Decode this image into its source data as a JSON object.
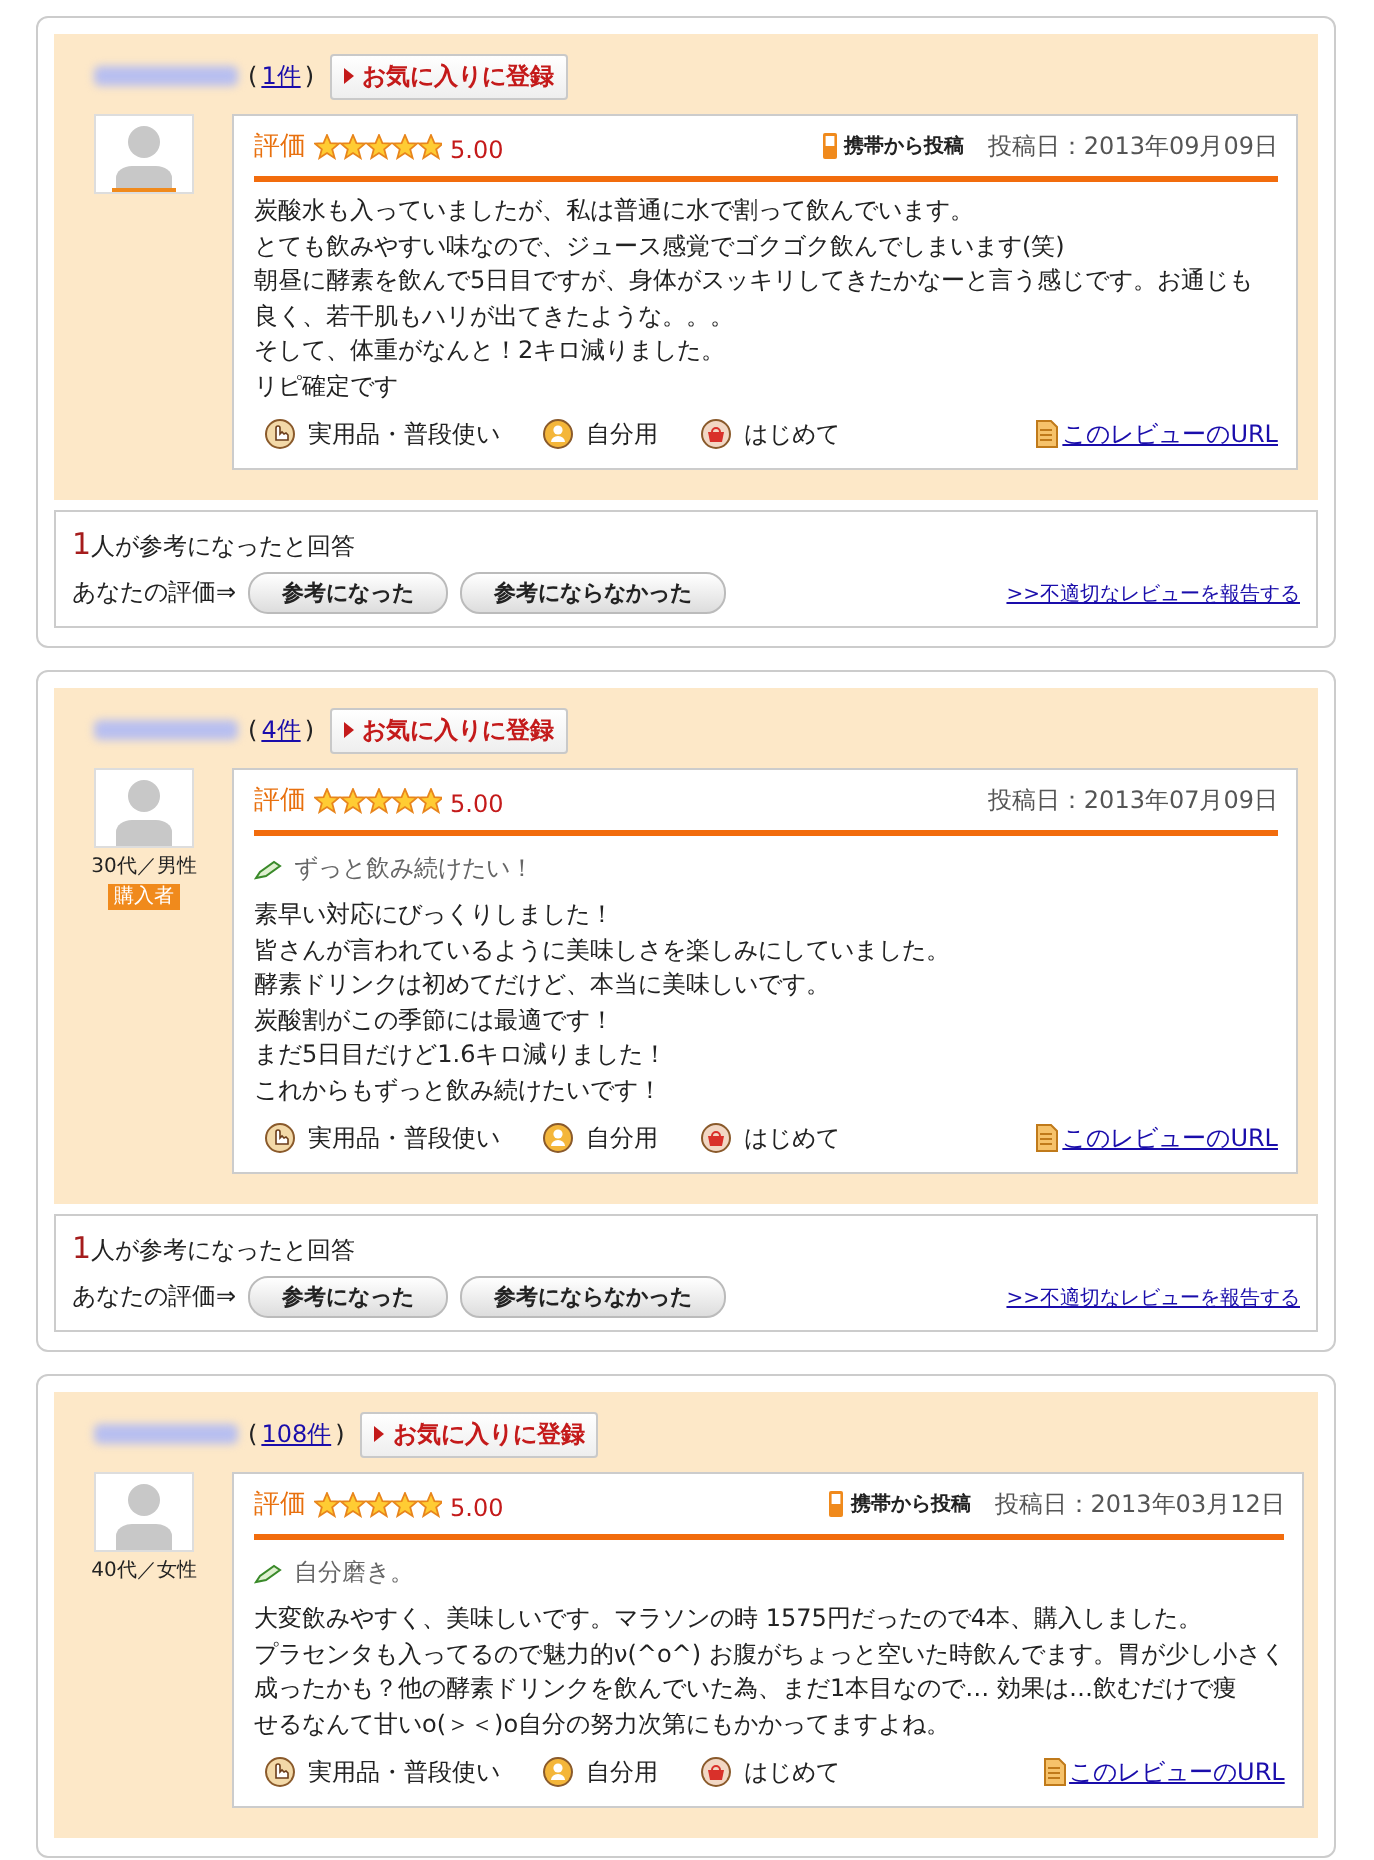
{
  "reviews": [
    {
      "count": {
        "open": "(",
        "link": "1件",
        "close": ")"
      },
      "favorite": "お気に入りに登録",
      "rating_label": "評価",
      "stars": 5,
      "score": "5.00",
      "mobile": "携帯から投稿",
      "date": "投稿日：2013年09月09日",
      "body": [
        "炭酸水も入っていましたが、私は普通に水で割って飲んでいます。",
        "とても飲みやすい味なので、ジュース感覚でゴクゴク飲んでしまいます(笑)",
        "朝昼に酵素を飲んで5日目ですが、身体がスッキリしてきたかなーと言う感じです。お通じも",
        "良く、若干肌もハリが出てきたような。。。",
        "そして、体重がなんと！2キロ減りました。",
        "リピ確定です"
      ],
      "tags": [
        {
          "kind": "use",
          "label": "実用品・普段使い"
        },
        {
          "kind": "self",
          "label": "自分用"
        },
        {
          "kind": "first",
          "label": "はじめて"
        }
      ],
      "url_link": "このレビューのURL",
      "helpful": {
        "count": "1",
        "text": "人が参考になったと回答",
        "prompt": "あなたの評価⇒",
        "buttons": [
          "参考になった",
          "参考にならなかった"
        ],
        "report": ">>不適切なレビューを報告する"
      }
    },
    {
      "count": {
        "open": "(",
        "link": "4件",
        "close": ")"
      },
      "favorite": "お気に入りに登録",
      "demographic": "30代／男性",
      "purchaser": "購入者",
      "rating_label": "評価",
      "stars": 5,
      "score": "5.00",
      "date": "投稿日：2013年07月09日",
      "title": "ずっと飲み続けたい！",
      "body": [
        "素早い対応にびっくりしました！",
        "皆さんが言われているように美味しさを楽しみにしていました。",
        "酵素ドリンクは初めてだけど、本当に美味しいです。",
        "炭酸割がこの季節には最適です！",
        "まだ5日目だけど1.6キロ減りました！",
        "これからもずっと飲み続けたいです！"
      ],
      "tags": [
        {
          "kind": "use",
          "label": "実用品・普段使い"
        },
        {
          "kind": "self",
          "label": "自分用"
        },
        {
          "kind": "first",
          "label": "はじめて"
        }
      ],
      "url_link": "このレビューのURL",
      "helpful": {
        "count": "1",
        "text": "人が参考になったと回答",
        "prompt": "あなたの評価⇒",
        "buttons": [
          "参考になった",
          "参考にならなかった"
        ],
        "report": ">>不適切なレビューを報告する"
      }
    },
    {
      "count": {
        "open": "(",
        "link": "108件",
        "close": ")"
      },
      "favorite": "お気に入りに登録",
      "demographic": "40代／女性",
      "rating_label": "評価",
      "stars": 5,
      "score": "5.00",
      "mobile": "携帯から投稿",
      "date": "投稿日：2013年03月12日",
      "title": "自分磨き。",
      "body": [
        "大変飲みやすく、美味しいです。マラソンの時 1575円だったので4本、購入しました。",
        "プラセンタも入ってるので魅力的ν(^o^) お腹がちょっと空いた時飲んでます。胃が少し小さく",
        "成ったかも？他の酵素ドリンクを飲んでいた為、まだ1本目なので… 効果は…飲むだけで痩",
        "せるなんて甘いo(＞＜)o自分の努力次第にもかかってますよね。"
      ],
      "tags": [
        {
          "kind": "use",
          "label": "実用品・普段使い"
        },
        {
          "kind": "self",
          "label": "自分用"
        },
        {
          "kind": "first",
          "label": "はじめて"
        }
      ],
      "url_link": "このレビューのURL"
    }
  ]
}
